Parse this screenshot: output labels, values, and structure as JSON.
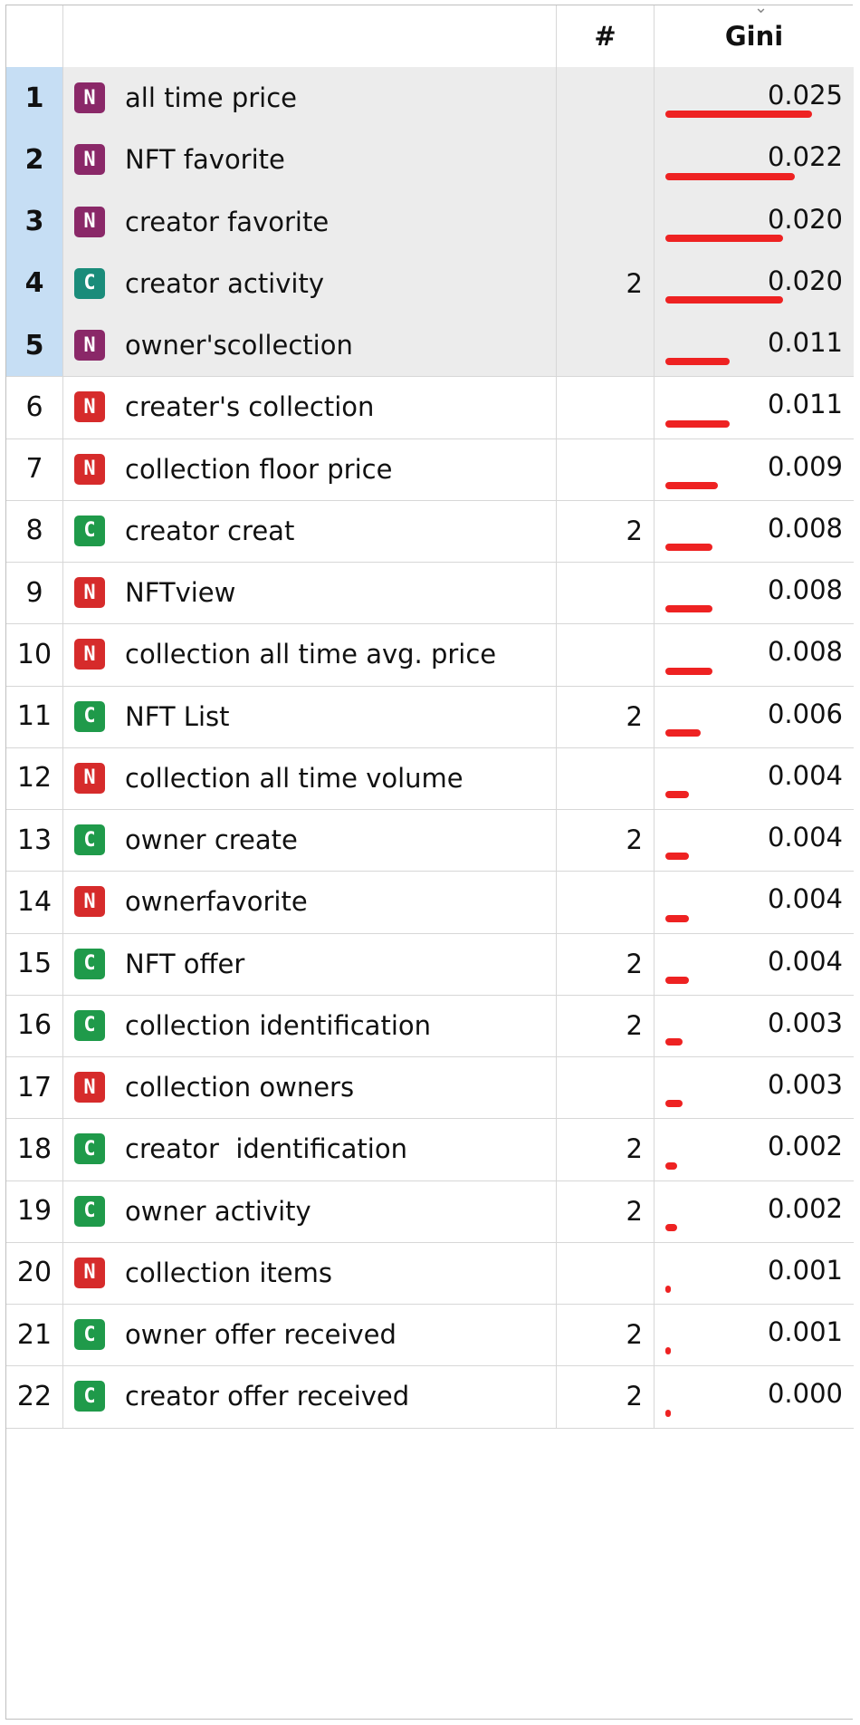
{
  "header": {
    "col_hash": "#",
    "col_gini": "Gini",
    "sort_indicator": "⌄"
  },
  "colors": {
    "selection_index_bg": "#c6def4",
    "selection_row_bg": "#ececec",
    "bar": "#ee2222",
    "type_badges": {
      "N_selected": "#8a2868",
      "N": "#d62b2b",
      "C_selected": "#1a8c7a",
      "C": "#1f9a4a"
    }
  },
  "max_gini": 0.025,
  "rows": [
    {
      "index": "1",
      "type": "N",
      "name": "all time price",
      "count": "",
      "gini": "0.025",
      "selected": true
    },
    {
      "index": "2",
      "type": "N",
      "name": "NFT favorite",
      "count": "",
      "gini": "0.022",
      "selected": true
    },
    {
      "index": "3",
      "type": "N",
      "name": "creator favorite",
      "count": "",
      "gini": "0.020",
      "selected": true
    },
    {
      "index": "4",
      "type": "C",
      "name": "creator activity",
      "count": "2",
      "gini": "0.020",
      "selected": true
    },
    {
      "index": "5",
      "type": "N",
      "name": "owner'scollection",
      "count": "",
      "gini": "0.011",
      "selected": true
    },
    {
      "index": "6",
      "type": "N",
      "name": "creater's collection",
      "count": "",
      "gini": "0.011",
      "selected": false
    },
    {
      "index": "7",
      "type": "N",
      "name": "collection floor price",
      "count": "",
      "gini": "0.009",
      "selected": false
    },
    {
      "index": "8",
      "type": "C",
      "name": "creator creat",
      "count": "2",
      "gini": "0.008",
      "selected": false
    },
    {
      "index": "9",
      "type": "N",
      "name": "NFTview",
      "count": "",
      "gini": "0.008",
      "selected": false
    },
    {
      "index": "10",
      "type": "N",
      "name": "collection all time avg. price",
      "count": "",
      "gini": "0.008",
      "selected": false
    },
    {
      "index": "11",
      "type": "C",
      "name": "NFT List",
      "count": "2",
      "gini": "0.006",
      "selected": false
    },
    {
      "index": "12",
      "type": "N",
      "name": "collection all time volume",
      "count": "",
      "gini": "0.004",
      "selected": false
    },
    {
      "index": "13",
      "type": "C",
      "name": "owner create",
      "count": "2",
      "gini": "0.004",
      "selected": false
    },
    {
      "index": "14",
      "type": "N",
      "name": "ownerfavorite",
      "count": "",
      "gini": "0.004",
      "selected": false
    },
    {
      "index": "15",
      "type": "C",
      "name": "NFT offer",
      "count": "2",
      "gini": "0.004",
      "selected": false
    },
    {
      "index": "16",
      "type": "C",
      "name": "collection identification",
      "count": "2",
      "gini": "0.003",
      "selected": false
    },
    {
      "index": "17",
      "type": "N",
      "name": "collection owners",
      "count": "",
      "gini": "0.003",
      "selected": false
    },
    {
      "index": "18",
      "type": "C",
      "name": "creator  identification",
      "count": "2",
      "gini": "0.002",
      "selected": false
    },
    {
      "index": "19",
      "type": "C",
      "name": "owner activity",
      "count": "2",
      "gini": "0.002",
      "selected": false
    },
    {
      "index": "20",
      "type": "N",
      "name": "collection items",
      "count": "",
      "gini": "0.001",
      "selected": false
    },
    {
      "index": "21",
      "type": "C",
      "name": "owner offer received",
      "count": "2",
      "gini": "0.001",
      "selected": false
    },
    {
      "index": "22",
      "type": "C",
      "name": "creator offer received",
      "count": "2",
      "gini": "0.000",
      "selected": false
    }
  ]
}
